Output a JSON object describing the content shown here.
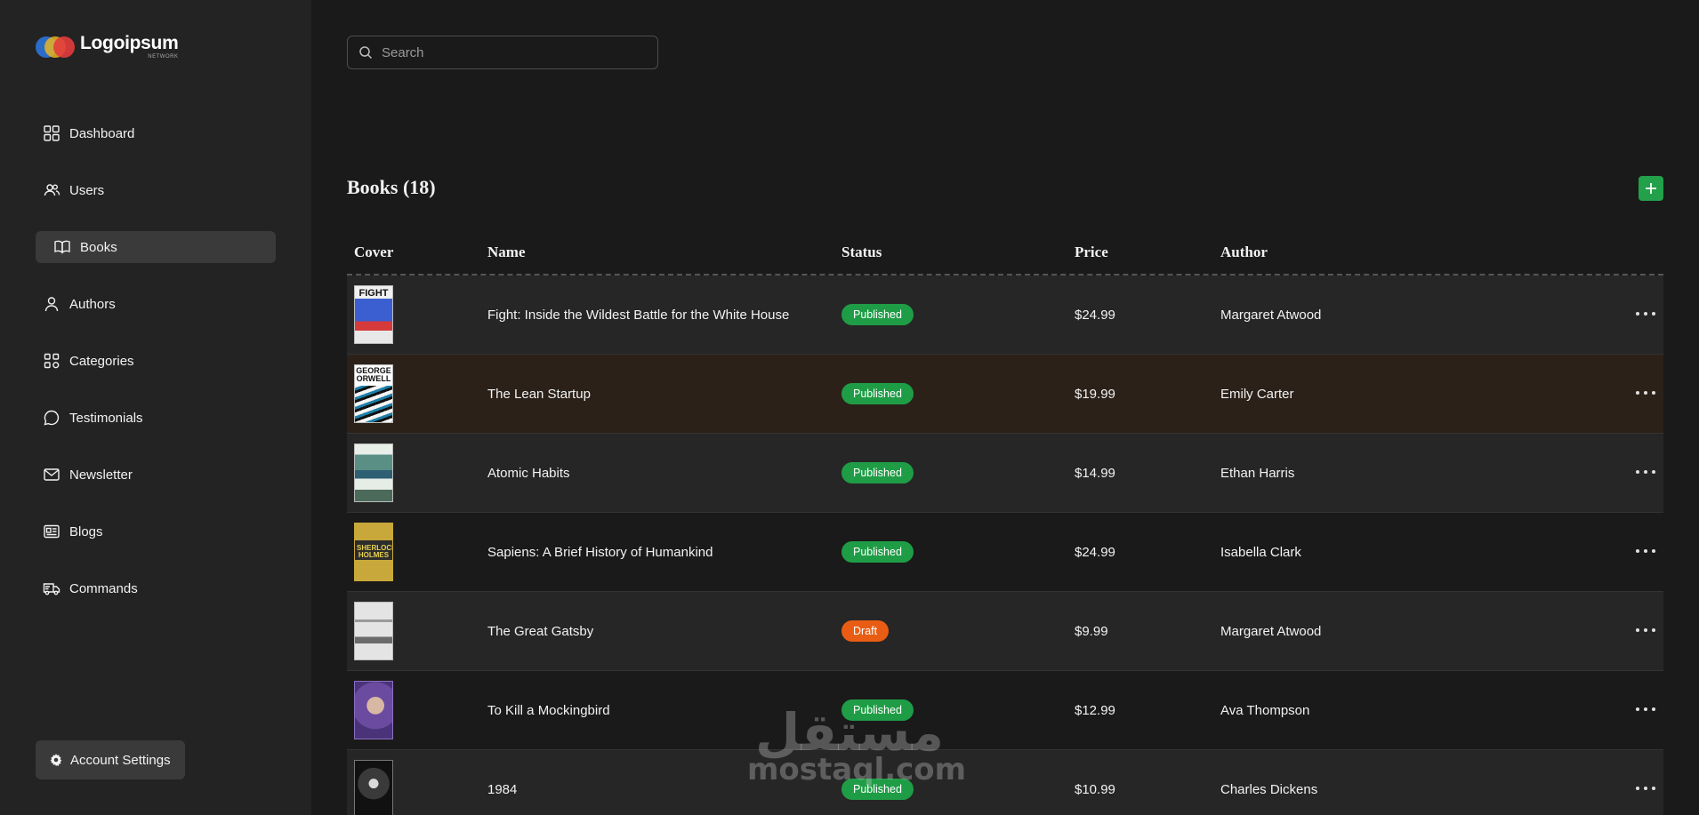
{
  "brand": {
    "name": "Logoipsum",
    "sub": "NETWORK",
    "colors": [
      "#2b74d9",
      "#e8b422",
      "#e23c3c"
    ]
  },
  "sidebar": {
    "items": [
      {
        "label": "Dashboard",
        "icon": "dashboard-icon"
      },
      {
        "label": "Users",
        "icon": "users-icon"
      },
      {
        "label": "Books",
        "icon": "book-open-icon",
        "active": true
      },
      {
        "label": "Authors",
        "icon": "user-icon"
      },
      {
        "label": "Categories",
        "icon": "categories-icon"
      },
      {
        "label": "Testimonials",
        "icon": "message-circle-icon"
      },
      {
        "label": "Newsletter",
        "icon": "mail-icon"
      },
      {
        "label": "Blogs",
        "icon": "newspaper-icon"
      },
      {
        "label": "Commands",
        "icon": "truck-icon"
      }
    ],
    "account_settings": "Account Settings"
  },
  "search": {
    "placeholder": "Search",
    "value": ""
  },
  "books": {
    "title": "Books (18)",
    "columns": [
      "Cover",
      "Name",
      "Status",
      "Price",
      "Author"
    ],
    "rows": [
      {
        "cover": "FIGHT",
        "name": "Fight: Inside the Wildest Battle for the White House",
        "status": "Published",
        "price": "$24.99",
        "author": "Margaret Atwood"
      },
      {
        "cover": "GEORGE ORWELL",
        "name": "The Lean Startup",
        "status": "Published",
        "price": "$19.99",
        "author": "Emily Carter"
      },
      {
        "cover": "",
        "name": "Atomic Habits",
        "status": "Published",
        "price": "$14.99",
        "author": "Ethan Harris"
      },
      {
        "cover": "SHERLOCK HOLMES",
        "name": "Sapiens: A Brief History of Humankind",
        "status": "Published",
        "price": "$24.99",
        "author": "Isabella Clark"
      },
      {
        "cover": "",
        "name": "The Great Gatsby",
        "status": "Draft",
        "price": "$9.99",
        "author": "Margaret Atwood"
      },
      {
        "cover": "",
        "name": "To Kill a Mockingbird",
        "status": "Published",
        "price": "$12.99",
        "author": "Ava Thompson"
      },
      {
        "cover": "",
        "name": "1984",
        "status": "Published",
        "price": "$10.99",
        "author": "Charles Dickens"
      }
    ]
  },
  "colors": {
    "accent": "#22a04a",
    "published": "#1f9d46",
    "draft": "#e85d13",
    "sidebar_bg": "#232323",
    "main_bg": "#1a1a1a"
  },
  "watermark": {
    "arabic": "مستقل",
    "latin": "mostaql.com"
  }
}
